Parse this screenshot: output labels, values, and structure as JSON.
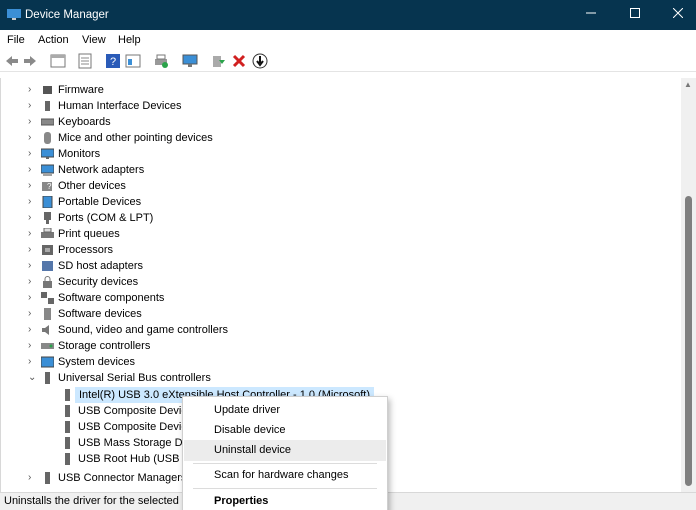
{
  "window": {
    "title": "Device Manager"
  },
  "menu": [
    "File",
    "Action",
    "View",
    "Help"
  ],
  "toolbar": [
    "back",
    "forward",
    "properties-pane",
    "grid",
    "help",
    "show-hidden",
    "print",
    "monitor",
    "install-driver",
    "uninstall",
    "update-driver"
  ],
  "tree": {
    "categories": [
      {
        "label": "Firmware",
        "icon": "chip-icon"
      },
      {
        "label": "Human Interface Devices",
        "icon": "usb-icon"
      },
      {
        "label": "Keyboards",
        "icon": "keyboard-icon"
      },
      {
        "label": "Mice and other pointing devices",
        "icon": "mouse-icon"
      },
      {
        "label": "Monitors",
        "icon": "monitor-icon"
      },
      {
        "label": "Network adapters",
        "icon": "network-icon"
      },
      {
        "label": "Other devices",
        "icon": "unknown-device-icon"
      },
      {
        "label": "Portable Devices",
        "icon": "portable-icon"
      },
      {
        "label": "Ports (COM & LPT)",
        "icon": "port-icon"
      },
      {
        "label": "Print queues",
        "icon": "printer-icon"
      },
      {
        "label": "Processors",
        "icon": "processor-icon"
      },
      {
        "label": "SD host adapters",
        "icon": "sd-icon"
      },
      {
        "label": "Security devices",
        "icon": "security-icon"
      },
      {
        "label": "Software components",
        "icon": "component-icon"
      },
      {
        "label": "Software devices",
        "icon": "software-device-icon"
      },
      {
        "label": "Sound, video and game controllers",
        "icon": "speaker-icon"
      },
      {
        "label": "Storage controllers",
        "icon": "storage-icon"
      },
      {
        "label": "System devices",
        "icon": "system-icon"
      }
    ],
    "usb": {
      "label": "Universal Serial Bus controllers",
      "children": [
        "Intel(R) USB 3.0 eXtensible Host Controller - 1.0 (Microsoft)",
        "USB Composite Device",
        "USB Composite Device",
        "USB Mass Storage Device",
        "USB Root Hub (USB 3.0)"
      ]
    },
    "after": [
      {
        "label": "USB Connector Managers",
        "icon": "usb-icon"
      }
    ]
  },
  "context_menu": {
    "update": "Update driver",
    "disable": "Disable device",
    "uninstall": "Uninstall device",
    "scan": "Scan for hardware changes",
    "properties": "Properties"
  },
  "status": {
    "text": "Uninstalls the driver for the selected device."
  },
  "colors": {
    "titlebar": "#06344f",
    "selection": "#cce8ff",
    "accent": "#0a6cc2"
  }
}
